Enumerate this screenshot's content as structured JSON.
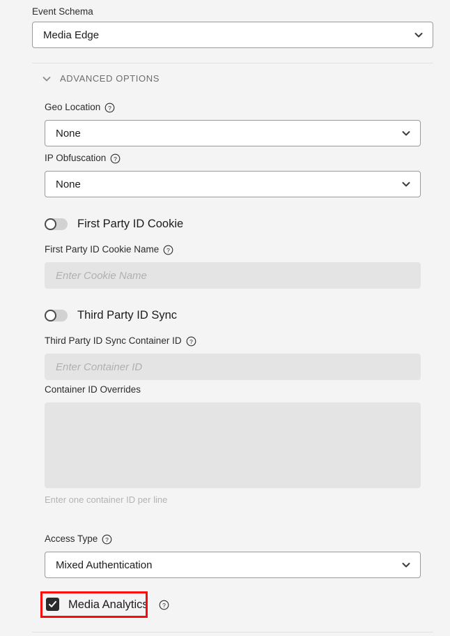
{
  "form": {
    "event_schema": {
      "label": "Event Schema",
      "value": "Media Edge"
    },
    "advanced_options": {
      "header": "ADVANCED OPTIONS",
      "geo_location": {
        "label": "Geo Location",
        "value": "None",
        "help": "?"
      },
      "ip_obfuscation": {
        "label": "IP Obfuscation",
        "value": "None",
        "help": "?"
      },
      "first_party_id_cookie": {
        "toggle_label": "First Party ID Cookie",
        "toggle_state": "off",
        "name_label": "First Party ID Cookie Name",
        "name_placeholder": "Enter Cookie Name",
        "name_value": "",
        "help": "?"
      },
      "third_party_id_sync": {
        "toggle_label": "Third Party ID Sync",
        "toggle_state": "off",
        "container_id_label": "Third Party ID Sync Container ID",
        "container_id_placeholder": "Enter Container ID",
        "container_id_value": "",
        "help": "?"
      },
      "container_id_overrides": {
        "label": "Container ID Overrides",
        "value": "",
        "helper_text": "Enter one container ID per line"
      },
      "access_type": {
        "label": "Access Type",
        "value": "Mixed Authentication",
        "help": "?"
      },
      "media_analytics": {
        "label": "Media Analytics",
        "checked": "true",
        "help": "?"
      }
    }
  },
  "colors": {
    "page_background": "#f4f4f4",
    "field_border": "#9a9a9a",
    "disabled_field_background": "#e4e4e4",
    "highlight_outline": "#fa0a0a",
    "checkbox_fill": "#2b2b2b",
    "toggle_track_off": "#d2d2d2"
  },
  "icons": {
    "chevron_down": "chevron-down-icon",
    "help": "help-circle-icon",
    "checkmark": "checkmark-icon"
  }
}
